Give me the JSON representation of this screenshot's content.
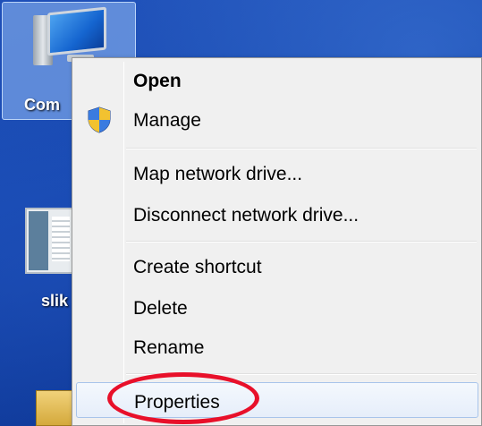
{
  "desktop": {
    "icons": [
      {
        "label": "Com"
      },
      {
        "label": "slik"
      }
    ]
  },
  "context_menu": {
    "groups": [
      [
        {
          "label": "Open",
          "bold": true
        },
        {
          "label": "Manage",
          "icon": "uac-shield-icon"
        }
      ],
      [
        {
          "label": "Map network drive..."
        },
        {
          "label": "Disconnect network drive..."
        }
      ],
      [
        {
          "label": "Create shortcut"
        },
        {
          "label": "Delete"
        },
        {
          "label": "Rename"
        }
      ],
      [
        {
          "label": "Properties",
          "highlighted": true
        }
      ]
    ]
  },
  "annotation": {
    "color": "#e8102a"
  }
}
